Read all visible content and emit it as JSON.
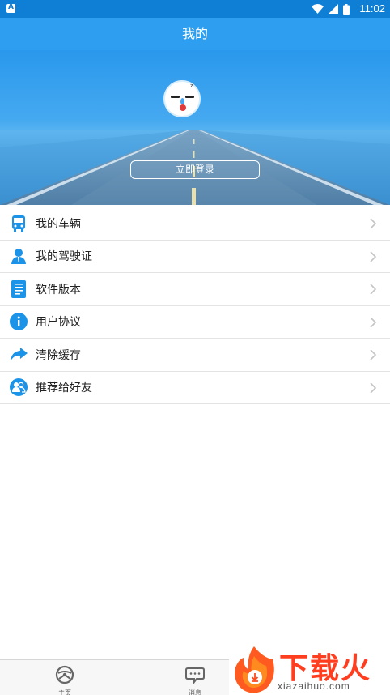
{
  "status_bar": {
    "time": "11:02"
  },
  "header": {
    "title": "我的"
  },
  "profile": {
    "login_label": "立即登录"
  },
  "menu": {
    "items": [
      {
        "label": "我的车辆",
        "icon": "bus-icon"
      },
      {
        "label": "我的驾驶证",
        "icon": "user-license-icon"
      },
      {
        "label": "软件版本",
        "icon": "document-icon"
      },
      {
        "label": "用户协议",
        "icon": "info-icon"
      },
      {
        "label": "清除缓存",
        "icon": "share-arrow-icon"
      },
      {
        "label": "推荐给好友",
        "icon": "friends-icon"
      }
    ]
  },
  "tabbar": {
    "tabs": [
      {
        "label": "主页",
        "icon": "steering-wheel-icon"
      },
      {
        "label": "消息",
        "icon": "message-icon"
      }
    ]
  },
  "watermark": {
    "text": "下载火",
    "url": "xiazaihuo.com"
  },
  "colors": {
    "accent": "#2e9ff0",
    "statusbar": "#0f7fd6",
    "icon_blue": "#1a93e8"
  }
}
